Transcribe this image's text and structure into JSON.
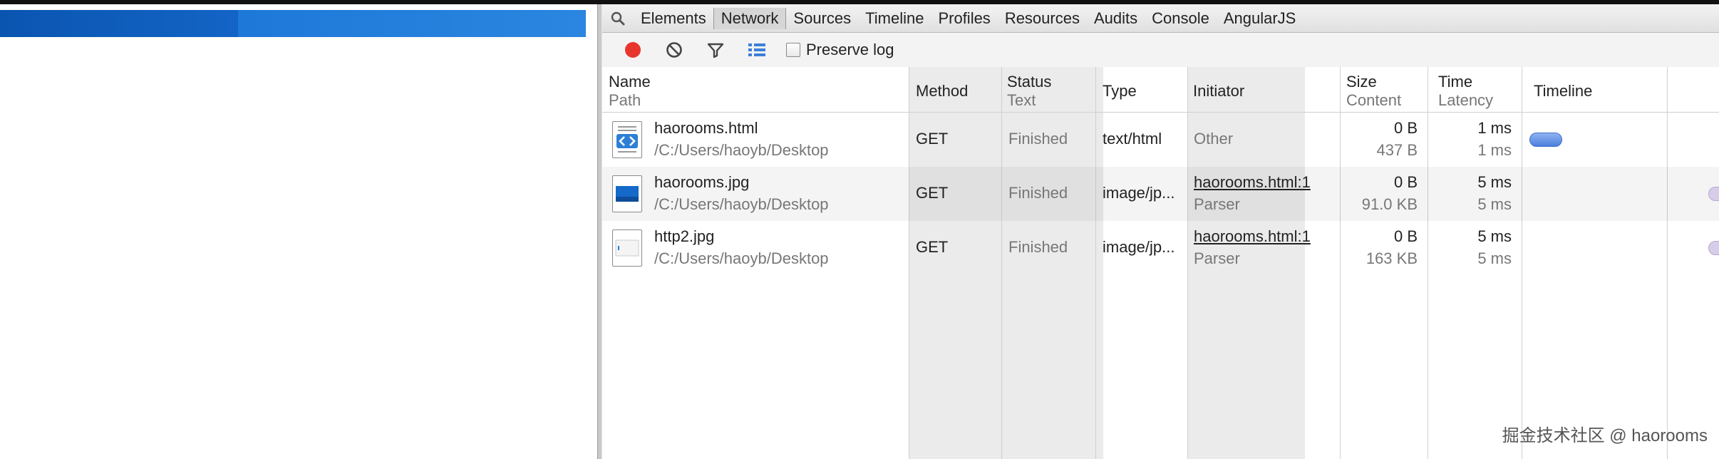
{
  "devtools": {
    "tabs": [
      "Elements",
      "Network",
      "Sources",
      "Timeline",
      "Profiles",
      "Resources",
      "Audits",
      "Console",
      "AngularJS"
    ],
    "selected_tab": "Network",
    "preserve_log_label": "Preserve log",
    "preserve_log_checked": false
  },
  "columns": {
    "name": "Name",
    "path": "Path",
    "method": "Method",
    "status": "Status",
    "text": "Text",
    "type": "Type",
    "initiator": "Initiator",
    "size": "Size",
    "content": "Content",
    "time": "Time",
    "latency": "Latency",
    "timeline": "Timeline"
  },
  "rows": [
    {
      "name": "haorooms.html",
      "path": "/C:/Users/haoyb/Desktop",
      "method": "GET",
      "status": "Finished",
      "type": "text/html",
      "initiator": "Other",
      "initiator_sub": "",
      "size": "0 B",
      "content": "437 B",
      "time": "1 ms",
      "latency": "1 ms",
      "icon": "html-file-icon"
    },
    {
      "name": "haorooms.jpg",
      "path": "/C:/Users/haoyb/Desktop",
      "method": "GET",
      "status": "Finished",
      "type": "image/jp...",
      "initiator": "haorooms.html:1",
      "initiator_sub": "Parser",
      "size": "0 B",
      "content": "91.0 KB",
      "time": "5 ms",
      "latency": "5 ms",
      "icon": "image-file-icon"
    },
    {
      "name": "http2.jpg",
      "path": "/C:/Users/haoyb/Desktop",
      "method": "GET",
      "status": "Finished",
      "type": "image/jp...",
      "initiator": "haorooms.html:1",
      "initiator_sub": "Parser",
      "size": "0 B",
      "content": "163 KB",
      "time": "5 ms",
      "latency": "5 ms",
      "icon": "blank-image-file-icon"
    }
  ],
  "watermark": "掘金技术社区 @ haorooms",
  "colors": {
    "record": "#e8362f",
    "page_banner": "#1364c6",
    "timeline_bar": "#5b8be0"
  }
}
